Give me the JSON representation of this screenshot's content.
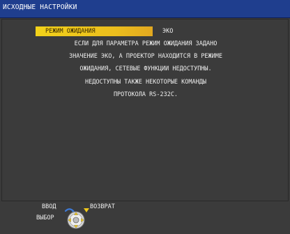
{
  "menu": {
    "title": "ИСХОДНЫЕ НАСТРОЙКИ"
  },
  "setting": {
    "label": "РЕЖИМ ОЖИДАНИЯ",
    "value": "ЭКО"
  },
  "info": {
    "lines": [
      "ЕСЛИ ДЛЯ ПАРАМЕТРА РЕЖИМ ОЖИДАНИЯ ЗАДАНО",
      "ЗНАЧЕНИЕ ЭКО, А ПРОЕКТОР НАХОДИТСЯ В РЕЖИМЕ",
      "ОЖИДАНИЯ, СЕТЕВЫЕ ФУНКЦИИ НЕДОСТУПНЫ.",
      "НЕДОСТУПНЫ ТАКЖЕ НЕКОТОРЫЕ КОМАНДЫ",
      "ПРОТОКОЛА RS-232C."
    ]
  },
  "footer": {
    "enter_label": "ВВОД",
    "select_label": "ВЫБОР",
    "return_label": "ВОЗВРАТ"
  },
  "colors": {
    "title_bar": "#1f3e8e",
    "highlight": "#f0c81c",
    "background": "#3a3a3a"
  },
  "icons": [
    "dpad-icon",
    "enter-arrow-icon",
    "return-arrow-icon"
  ]
}
